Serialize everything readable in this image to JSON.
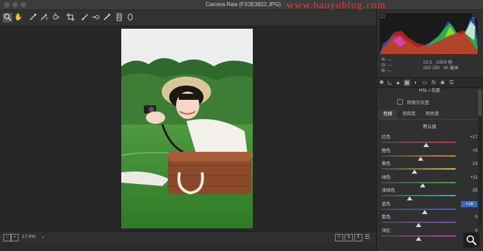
{
  "window": {
    "title": "Camera Raw (FX3E3822.JPG)",
    "watermark": "www.baoyublog.com"
  },
  "toolbar": {
    "tools": [
      "zoom-tool",
      "hand-tool",
      "white-balance-tool",
      "color-sampler-tool",
      "targeted-adjustment-tool",
      "crop-tool",
      "straighten-tool",
      "spot-removal-tool",
      "red-eye-tool",
      "adjustment-brush",
      "graduated-filter",
      "radial-filter"
    ]
  },
  "statusbar": {
    "zoom": "17.6%",
    "zoom_arrow": "⌄"
  },
  "info": {
    "r": "R: ---",
    "g": "G: ---",
    "b": "B: ---",
    "aperture": "f/2.5",
    "shutter": "1/500 秒",
    "iso": "ISO 250",
    "focal": "50 毫米"
  },
  "panel": {
    "title": "HSL / 灰度",
    "grayscale_label": "转换为灰度",
    "tabs": [
      "色相",
      "饱和度",
      "明亮度"
    ],
    "selected_tab": 0,
    "defaults_link": "默认值",
    "sliders": [
      {
        "label": "红色",
        "value": "+17",
        "pos": 0.6,
        "color": "#d23a3a"
      },
      {
        "label": "橙色",
        "value": "+5",
        "pos": 0.53,
        "color": "#d98a2b"
      },
      {
        "label": "黄色",
        "value": "-13",
        "pos": 0.44,
        "color": "#d8c13a"
      },
      {
        "label": "绿色",
        "value": "+11",
        "pos": 0.56,
        "color": "#3fa84a"
      },
      {
        "label": "浅绿色",
        "value": "-25",
        "pos": 0.38,
        "color": "#35b3b0"
      },
      {
        "label": "蓝色",
        "value": "+16",
        "pos": 0.58,
        "color": "#3a64d0",
        "highlight": true
      },
      {
        "label": "紫色",
        "value": "0",
        "pos": 0.5,
        "color": "#8a4bc9"
      },
      {
        "label": "洋红",
        "value": "0",
        "pos": 0.5,
        "color": "#c93aa4"
      }
    ]
  },
  "accent": "#3f69b0"
}
